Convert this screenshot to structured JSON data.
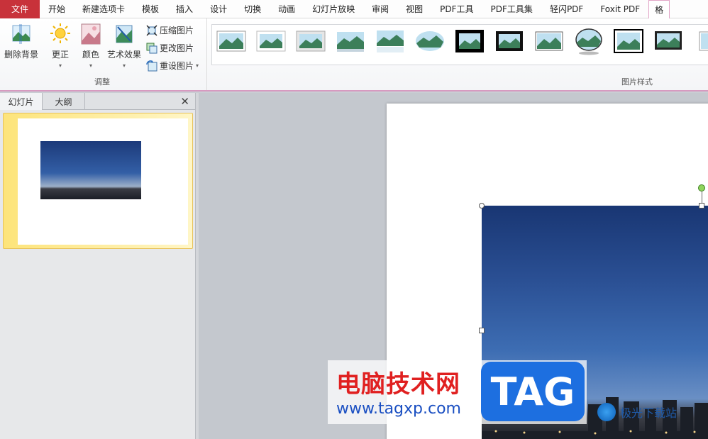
{
  "menu": {
    "file": "文件",
    "items": [
      "开始",
      "新建选项卡",
      "模板",
      "插入",
      "设计",
      "切换",
      "动画",
      "幻灯片放映",
      "审阅",
      "视图",
      "PDF工具",
      "PDF工具集",
      "轻闪PDF",
      "Foxit PDF"
    ],
    "active_tab": "格"
  },
  "ribbon": {
    "adjust": {
      "remove_bg": "删除背景",
      "correct": "更正",
      "color": "颜色",
      "art_effects": "艺术效果",
      "compress": "压缩图片",
      "change": "更改图片",
      "reset": "重设图片",
      "label": "调整"
    },
    "styles": {
      "label": "图片样式"
    }
  },
  "left_pane": {
    "tabs": [
      "幻灯片",
      "大纲"
    ],
    "close": "✕",
    "slide_number": ""
  },
  "watermark": {
    "cn": "电脑技术网",
    "url": "www.tagxp.com",
    "tag": "TAG",
    "site2": "极光下载站"
  },
  "colors": {
    "file_tab": "#c8323a",
    "accent_border": "#d79ac0",
    "selection": "#fde47a"
  }
}
